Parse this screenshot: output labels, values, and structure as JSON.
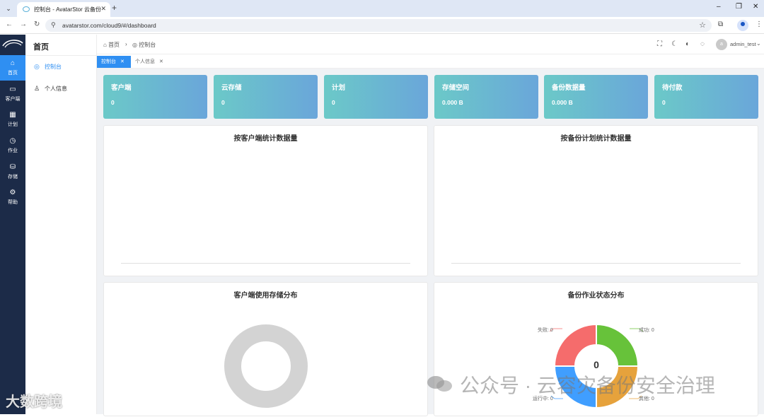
{
  "browser": {
    "tab_title": "控制台 - AvatarStor 云备份",
    "url": "avatarstor.com/cloud9/#/dashboard",
    "new_tab_glyph": "+",
    "tab_close_glyph": "✕"
  },
  "nav": {
    "items": [
      {
        "label": "首页",
        "icon": "home-icon",
        "glyph": "⌂"
      },
      {
        "label": "客户端",
        "icon": "monitor-icon",
        "glyph": "▭"
      },
      {
        "label": "计划",
        "icon": "calendar-icon",
        "glyph": "▦"
      },
      {
        "label": "作业",
        "icon": "clock-icon",
        "glyph": "◷"
      },
      {
        "label": "存储",
        "icon": "storage-icon",
        "glyph": "⛁"
      },
      {
        "label": "帮助",
        "icon": "gear-icon",
        "glyph": "⚙"
      }
    ]
  },
  "subnav": {
    "title": "首页",
    "items": [
      {
        "label": "控制台",
        "icon": "dashboard-icon",
        "glyph": "◎"
      },
      {
        "label": "个人信息",
        "icon": "user-icon",
        "glyph": "♙"
      }
    ]
  },
  "breadcrumb": {
    "home": "首页",
    "separator": "›",
    "current": "控制台"
  },
  "header": {
    "user_initial": "a",
    "user_name": "admin_test"
  },
  "tags": [
    {
      "label": "控制台"
    },
    {
      "label": "个人信息"
    }
  ],
  "stats": [
    {
      "label": "客户端",
      "value": "0"
    },
    {
      "label": "云存储",
      "value": "0"
    },
    {
      "label": "计划",
      "value": "0"
    },
    {
      "label": "存储空间",
      "value": "0.000 B"
    },
    {
      "label": "备份数据量",
      "value": "0.000 B"
    },
    {
      "label": "待付款",
      "value": "0"
    }
  ],
  "panels": {
    "by_client": "按客户端统计数据量",
    "by_plan": "按备份计划统计数据量",
    "client_storage": "客户端使用存储分布",
    "job_status": "备份作业状态分布"
  },
  "job_status_chart": {
    "center_value": "0",
    "slices": [
      {
        "label": "成功: 0",
        "color": "#67c23a"
      },
      {
        "label": "其他: 0",
        "color": "#e6a23c"
      },
      {
        "label": "运行中: 0",
        "color": "#409eff"
      },
      {
        "label": "失败: 0",
        "color": "#f56c6c"
      }
    ]
  },
  "client_storage_chart": {
    "ring_color": "#d3d3d3"
  },
  "watermark": {
    "text": "公众号 · 云容灾备份安全治理",
    "corner": "大数跨境"
  }
}
